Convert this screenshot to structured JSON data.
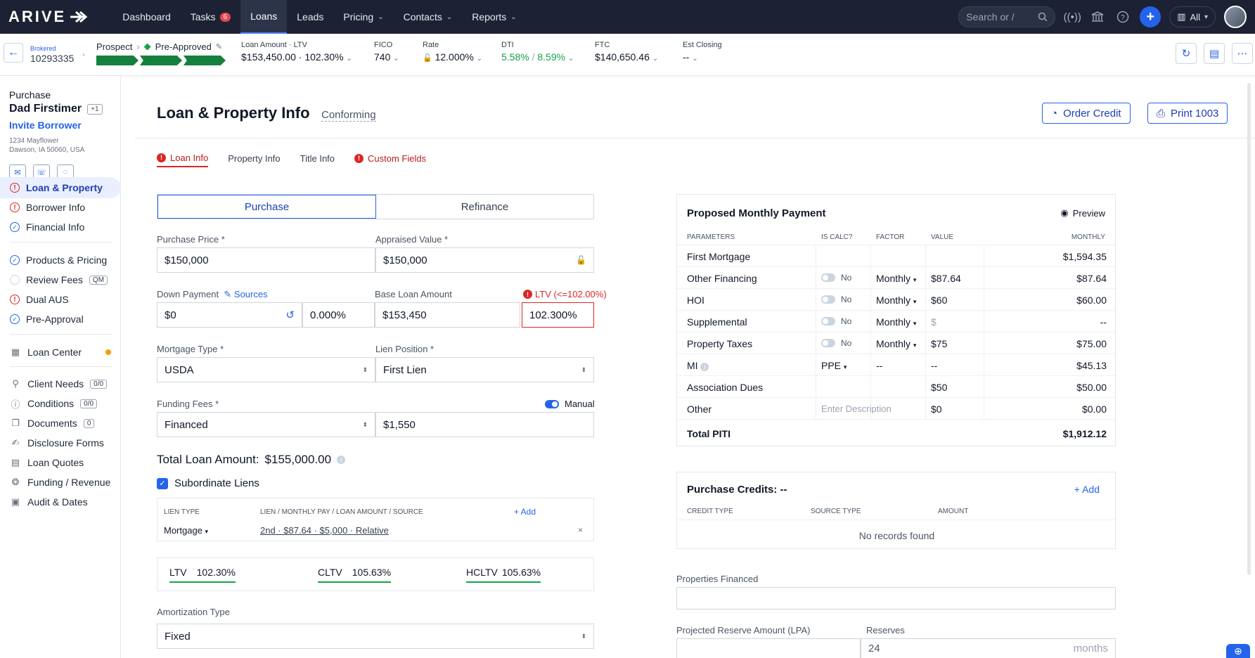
{
  "nav": {
    "logo": "ARIVE",
    "links": [
      {
        "label": "Dashboard"
      },
      {
        "label": "Tasks",
        "badge": "6"
      },
      {
        "label": "Loans"
      },
      {
        "label": "Leads"
      },
      {
        "label": "Pricing"
      },
      {
        "label": "Contacts"
      },
      {
        "label": "Reports"
      }
    ],
    "search_placeholder": "Search or /",
    "scope": "All"
  },
  "loan_bar": {
    "brokered": "Brokered",
    "loan_number": "10293335",
    "stage_from": "Prospect",
    "stage_to": "Pre-Approved",
    "loan_amount_label": "Loan Amount · LTV",
    "loan_amount": "$153,450.00",
    "ltv": "102.30%",
    "fico_label": "FICO",
    "fico": "740",
    "rate_label": "Rate",
    "rate": "12.000%",
    "dti_label": "DTI",
    "dti_front": "5.58%",
    "dti_back": "8.59%",
    "ftc_label": "FTC",
    "ftc": "$140,650.46",
    "est_closing_label": "Est Closing",
    "est_closing": "--"
  },
  "sidebar": {
    "loan_type": "Purchase",
    "borrower": "Dad Firstimer",
    "more": "+1",
    "invite": "Invite Borrower",
    "address1": "1234 Mayflower",
    "address2": "Dawson, IA 50060, USA",
    "items": [
      {
        "label": "Loan & Property",
        "status": "error"
      },
      {
        "label": "Borrower Info",
        "status": "error"
      },
      {
        "label": "Financial Info",
        "status": "ok"
      },
      {
        "label": "Products & Pricing",
        "status": "ok"
      },
      {
        "label": "Review Fees",
        "status": "empty",
        "tag": "QM"
      },
      {
        "label": "Dual AUS",
        "status": "error"
      },
      {
        "label": "Pre-Approval",
        "status": "ok"
      },
      {
        "label": "Loan Center"
      },
      {
        "label": "Client Needs",
        "tag": "0/0"
      },
      {
        "label": "Conditions",
        "tag": "0/0"
      },
      {
        "label": "Documents",
        "tag": "0"
      },
      {
        "label": "Disclosure Forms"
      },
      {
        "label": "Loan Quotes"
      },
      {
        "label": "Funding / Revenue"
      },
      {
        "label": "Audit & Dates"
      }
    ]
  },
  "page": {
    "title": "Loan & Property Info",
    "subtitle": "Conforming",
    "order_credit": "Order Credit",
    "print": "Print 1003",
    "tabs": [
      "Loan Info",
      "Property Info",
      "Title Info",
      "Custom Fields"
    ]
  },
  "form": {
    "purpose_options": [
      "Purchase",
      "Refinance"
    ],
    "purchase_price_label": "Purchase Price *",
    "purchase_price": "$150,000",
    "appraised_value_label": "Appraised Value *",
    "appraised_value": "$150,000",
    "down_payment_label": "Down Payment",
    "sources": "Sources",
    "down_payment": "$0",
    "down_payment_pct": "0.000%",
    "base_loan_label": "Base Loan Amount",
    "base_loan": "$153,450",
    "ltv_error": "LTV (<=102.00%)",
    "ltv_value": "102.300%",
    "mortgage_type_label": "Mortgage Type *",
    "mortgage_type": "USDA",
    "lien_position_label": "Lien Position *",
    "lien_position": "First Lien",
    "funding_fees_label": "Funding Fees *",
    "manual": "Manual",
    "funding_fees": "Financed",
    "funding_amount": "$1,550",
    "total_loan_label": "Total Loan Amount:",
    "total_loan": "$155,000.00",
    "subordinate_liens": "Subordinate Liens",
    "lien_type_hdr": "LIEN TYPE",
    "lien_detail_hdr": "LIEN / MONTHLY PAY / LOAN AMOUNT / SOURCE",
    "add": "+ Add",
    "lien_type": "Mortgage",
    "lien_detail": "2nd  · $87.64 · $5,000 · Relative",
    "ratios": [
      {
        "label": "LTV",
        "value": "102.30%"
      },
      {
        "label": "CLTV",
        "value": "105.63%"
      },
      {
        "label": "HCLTV",
        "value": "105.63%"
      }
    ],
    "amortization_label": "Amortization Type",
    "amortization": "Fixed"
  },
  "payment": {
    "title": "Proposed Monthly Payment",
    "preview": "Preview",
    "headers": [
      "PARAMETERS",
      "IS CALC?",
      "FACTOR",
      "VALUE",
      "MONTHLY"
    ],
    "rows": [
      {
        "param": "First Mortgage",
        "calc": "",
        "factor": "",
        "value": "",
        "monthly": "$1,594.35"
      },
      {
        "param": "Other Financing",
        "calc": "No",
        "factor": "Monthly",
        "value": "$87.64",
        "monthly": "$87.64"
      },
      {
        "param": "HOI",
        "calc": "No",
        "factor": "Monthly",
        "value": "$60",
        "monthly": "$60.00"
      },
      {
        "param": "Supplemental",
        "calc": "No",
        "factor": "Monthly",
        "value": "$",
        "monthly": "--"
      },
      {
        "param": "Property Taxes",
        "calc": "No",
        "factor": "Monthly",
        "value": "$75",
        "monthly": "$75.00"
      },
      {
        "param": "MI",
        "calc": "PPE",
        "factor": "--",
        "value": "--",
        "monthly": "$45.13"
      },
      {
        "param": "Association Dues",
        "calc": "",
        "factor": "",
        "value": "$50",
        "monthly": "$50.00"
      },
      {
        "param": "Other",
        "calc": "Enter Description",
        "factor": "",
        "value": "$0",
        "monthly": "$0.00"
      }
    ],
    "total_label": "Total PITI",
    "total": "$1,912.12"
  },
  "credits": {
    "title": "Purchase Credits: --",
    "add": "+ Add",
    "headers": [
      "CREDIT TYPE",
      "SOURCE TYPE",
      "AMOUNT"
    ],
    "empty": "No records found"
  },
  "properties_financed_label": "Properties Financed",
  "reserve_label": "Projected Reserve Amount (LPA)",
  "reserves_label": "Reserves",
  "reserves_value": "24",
  "reserves_unit": "months",
  "colors": {
    "nav_bg": "#1c2233",
    "accent": "#2563eb",
    "error": "#dc2626",
    "success": "#16a34a"
  }
}
